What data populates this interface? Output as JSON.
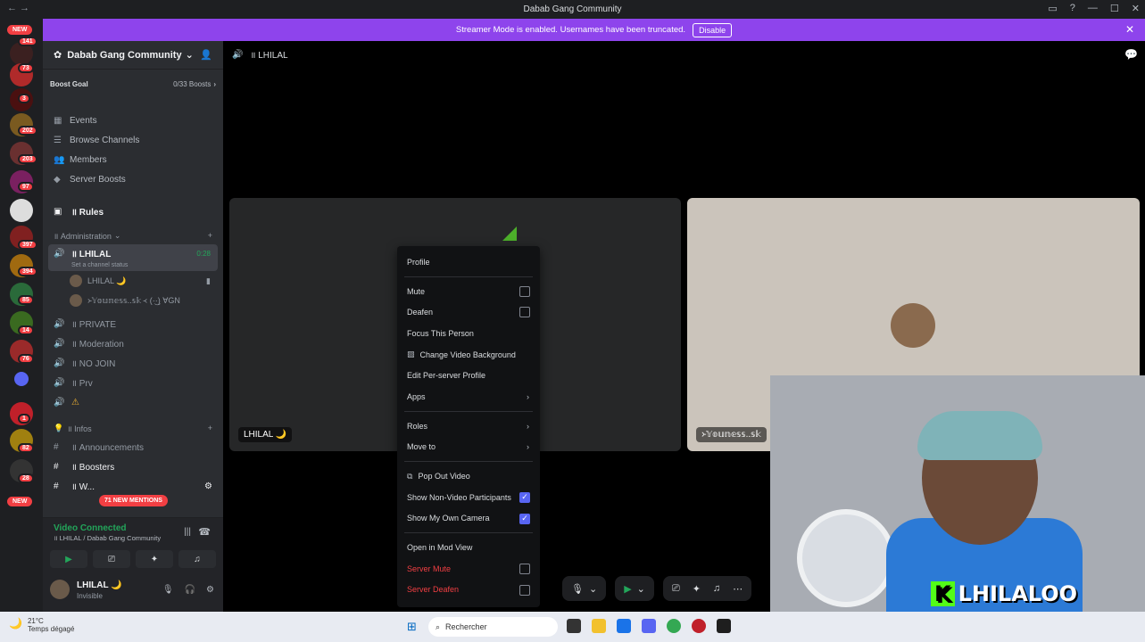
{
  "window": {
    "title": "Dabab Gang Community"
  },
  "banner": {
    "text": "Streamer Mode is enabled. Usernames have been truncated.",
    "button": "Disable"
  },
  "servers": {
    "new_top": "NEW",
    "new_bottom": "NEW",
    "badges": [
      "141",
      "73",
      "3",
      "202",
      "203",
      "97",
      "397",
      "394",
      "85",
      "14",
      "76",
      "1",
      "82",
      "28"
    ]
  },
  "server": {
    "name": "Dabab Gang Community",
    "boost_goal": "Boost Goal",
    "boost_count": "0/33 Boosts"
  },
  "nav": [
    "Events",
    "Browse Channels",
    "Members",
    "Server Boosts"
  ],
  "rules": "॥ Rules",
  "category_admin": "॥ Administration",
  "active_channel": {
    "name": "॥ LHILAL",
    "time": "0:28",
    "status": "Set a channel status"
  },
  "members": [
    "LHILAL 🌙",
    "᚛𝕐𝕠𝕦𝕟𝕖𝕤𝕤..𝕤𝕜 ᚜ (·͜·) ∀GN"
  ],
  "voice_channels": [
    "॥ PRIVATE",
    "॥ Moderation",
    "॥ NO JOIN",
    "॥ Prv",
    ""
  ],
  "category_infos": "॥ Infos",
  "text_channels": [
    "॥ Announcements",
    "॥ Boosters",
    "॥ W..."
  ],
  "mentions": "71 NEW MENTIONS",
  "rtc": {
    "status": "Video Connected",
    "sub": "॥ LHILAL / Dabab Gang Community"
  },
  "user": {
    "name": "LHILAL 🌙",
    "status": "Invisible"
  },
  "stage": {
    "channel": "॥ LHILAL"
  },
  "tiles": [
    {
      "label": "LHILAL 🌙"
    },
    {
      "label": "᚛𝕐𝕠𝕦𝕟𝕖𝕤𝕤..𝕤𝕜"
    }
  ],
  "cam": {
    "brand": "LHILALOO",
    "brand_k": "K"
  },
  "menu": {
    "profile": "Profile",
    "mute": "Mute",
    "deafen": "Deafen",
    "focus": "Focus This Person",
    "change_bg": "Change Video Background",
    "edit_profile": "Edit Per-server Profile",
    "apps": "Apps",
    "roles": "Roles",
    "move_to": "Move to",
    "pop_out": "Pop Out Video",
    "show_non_video": "Show Non-Video Participants",
    "show_own": "Show My Own Camera",
    "mod_view": "Open in Mod View",
    "server_mute": "Server Mute",
    "server_deafen": "Server Deafen"
  },
  "taskbar": {
    "temp": "21°C",
    "weather": "Temps dégagé",
    "search": "Rechercher"
  }
}
